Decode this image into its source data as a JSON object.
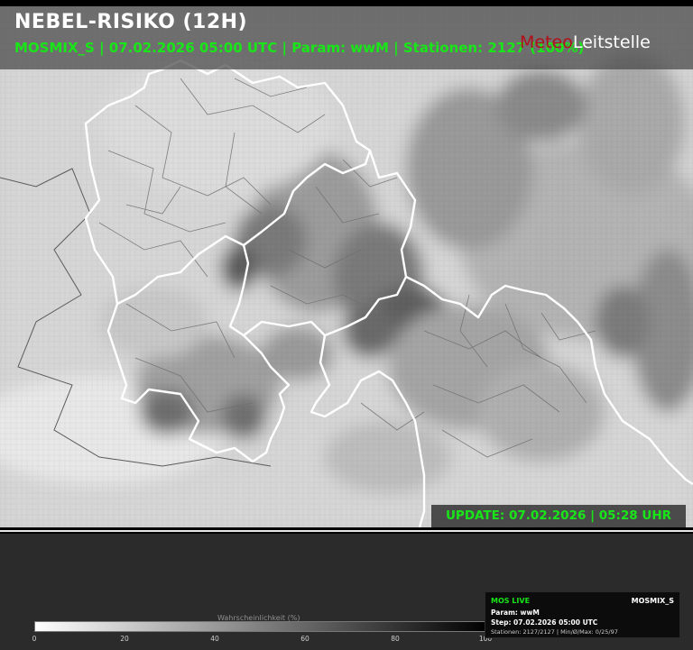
{
  "header": {
    "title": "NEBEL-RISIKO (12H)",
    "subtitle": "MOSMIX_S | 07.02.2026 05:00 UTC | Param: wwM | Stationen: 2127 (100%)"
  },
  "brand": {
    "part1": "Meteo",
    "part2": "Leitstelle"
  },
  "update_label": "UPDATE: 07.02.2026 | 05:28 UHR",
  "legend": {
    "title": "Wahrscheinlichkeit (%)",
    "ticks": [
      "0",
      "20",
      "40",
      "60",
      "80",
      "100"
    ],
    "color_min": "#ffffff",
    "color_max": "#000000"
  },
  "info_box": {
    "live_label": "MOS LIVE",
    "model": "MOSMIX_S",
    "param": "Param: wwM",
    "step": "Step: 07.02.2026 05:00 UTC",
    "stats": "Stationen: 2127/2127  |  Min/Ø/Max: 0/25/97"
  },
  "colors": {
    "accent_green": "#19e619",
    "brand_red": "#b30f1a"
  }
}
